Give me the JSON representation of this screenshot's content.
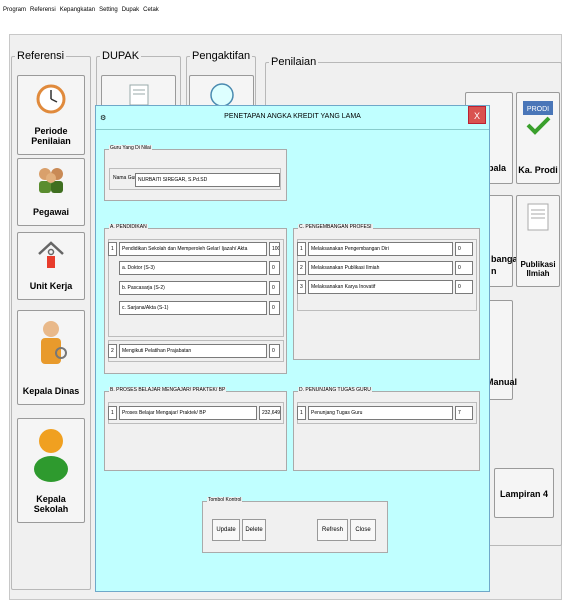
{
  "menubar": [
    "Program",
    "Referensi",
    "Kepangkatan",
    "Setting",
    "Dupak",
    "Cetak"
  ],
  "groups": {
    "referensi": "Referensi",
    "dupak": "DUPAK",
    "pengaktifan": "Pengaktifan",
    "penilaian": "Penilaian"
  },
  "nav": {
    "periode": "Periode Penilaian",
    "pegawai": "Pegawai",
    "unit_kerja": "Unit Kerja",
    "kepala_dinas": "Kepala Dinas",
    "kepala_sekolah": "Kepala Sekolah",
    "kepala_partial": "epala",
    "ka_prodi": "Ka. Prodi",
    "pengembangan_partial": "bangan",
    "pengembangan_partial2": "n",
    "publikasi": "Publikasi Ilmiah",
    "manual_partial": "Manual",
    "lampiran4": "Lampiran 4",
    "prodi_icon_text": "PRODI"
  },
  "dialog": {
    "title": "PENETAPAN ANGKA KREDIT YANG LAMA",
    "close": "X",
    "guru_panel": "Guru Yang Di Nilai",
    "nama_guru_label": "Nama Guru",
    "nama_guru_value": "NURBAITI SIREGAR, S.Pd.SD",
    "pendidikan": {
      "title": "A. PENDIDIKAN",
      "rows": [
        {
          "no": "1",
          "label": "Pendidikan Sekolah dan Memperoleh Gelar/ Ijazah/ Akta",
          "value": "100"
        },
        {
          "no": "",
          "label": "a. Doktor (S-3)",
          "value": "0"
        },
        {
          "no": "",
          "label": "b. Pascasarja (S-2)",
          "value": "0"
        },
        {
          "no": "",
          "label": "c. Sarjana/Akta (S-1)",
          "value": "0"
        },
        {
          "no": "2",
          "label": "Mengikuti Pelatihan Prajabatan",
          "value": "0"
        }
      ]
    },
    "pengembangan": {
      "title": "C. PENGEMBANGAN PROFESI",
      "rows": [
        {
          "no": "1",
          "label": "Melaksanakan Pengembangan Diri",
          "value": "0"
        },
        {
          "no": "2",
          "label": "Melaksanakan Publikasi Ilmiah",
          "value": "0"
        },
        {
          "no": "3",
          "label": "Melaksanakan Karya Inovatif",
          "value": "0"
        }
      ]
    },
    "proses": {
      "title": "B. PROSES BELAJAR MENGAJAR/ PRAKTEK/ BP",
      "rows": [
        {
          "no": "1",
          "label": "Proses Belajar Mengajar/ Praktek/ BP",
          "value": "232,649"
        }
      ]
    },
    "penunjang": {
      "title": "D. PENUNJANG TUGAS GURU",
      "rows": [
        {
          "no": "1",
          "label": "Penunjang Tugas Guru",
          "value": "7"
        }
      ]
    },
    "tombol": {
      "title": "Tombol Kontrol",
      "update": "Update",
      "delete": "Delete",
      "refresh": "Refresh",
      "close": "Close"
    }
  }
}
